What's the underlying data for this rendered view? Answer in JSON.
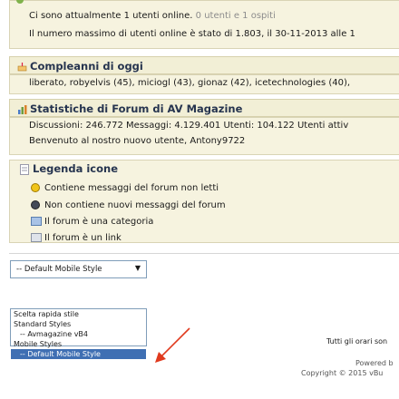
{
  "online": {
    "line1_a": "Ci sono attualmente",
    "line1_b": "1 utenti online.",
    "line1_c": "0 utenti e 1 ospiti",
    "line2": "Il numero massimo di utenti online è stato di 1.803, il 30-11-2013 alle 1"
  },
  "birthdays": {
    "title": "Compleanni di oggi",
    "list": "liberato, robyelvis (45), miciogl (43), gionaz (42), icetechnologies (40),"
  },
  "stats": {
    "title": "Statistiche di Forum di AV Magazine",
    "line1": "Discussioni: 246.772  Messaggi: 4.129.401  Utenti: 104.122  Utenti attiv",
    "line2": "Benvenuto al nostro nuovo utente, Antony9722"
  },
  "legend": {
    "title": "Legenda icone",
    "items": [
      "Contiene messaggi del forum non letti",
      "Non contiene nuovi messaggi del forum",
      "Il forum è una categoria",
      "Il forum è un link"
    ]
  },
  "style_select": {
    "selected": "-- Default Mobile Style",
    "options": [
      "Scelta rapida stile",
      "Standard Styles",
      "-- Avmagazine vB4",
      "Mobile Styles",
      "-- Default Mobile Style"
    ]
  },
  "footer": {
    "timezone": "Tutti gli orari son",
    "powered": "Powered b",
    "copyright": "Copyright © 2015 vBu"
  },
  "colors": {
    "accent": "#3f6fb3",
    "arrow": "#e03a1e",
    "header_text": "#26344f"
  },
  "icons": [
    "user-icon",
    "birthday-icon",
    "stats-icon",
    "legend-icon",
    "new-posts-icon",
    "no-new-posts-icon",
    "category-icon",
    "link-icon"
  ]
}
